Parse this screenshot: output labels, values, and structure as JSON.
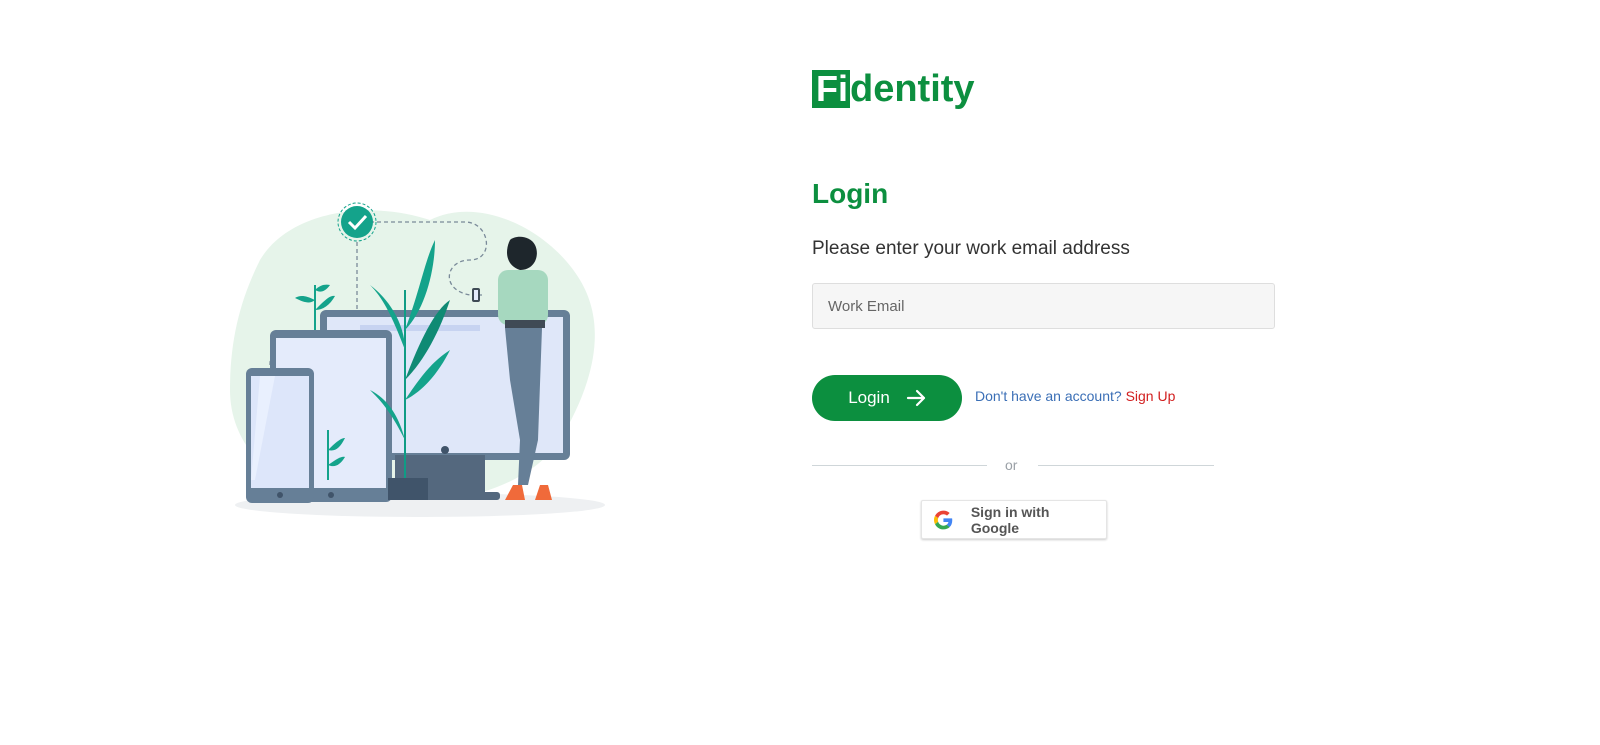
{
  "brand": {
    "logo_mark": "Fi",
    "logo_text": "dentity",
    "accent_color": "#0c8f3f"
  },
  "login": {
    "title": "Login",
    "subtitle": "Please enter your work email address",
    "email_placeholder": "Work Email",
    "button_label": "Login",
    "signup_prompt": "Don't have an account?",
    "signup_link": "Sign Up",
    "divider_text": "or",
    "google_label": "Sign in with Google"
  },
  "icons": {
    "arrow": "arrow-right-icon",
    "google": "google-icon",
    "check": "check-icon"
  }
}
